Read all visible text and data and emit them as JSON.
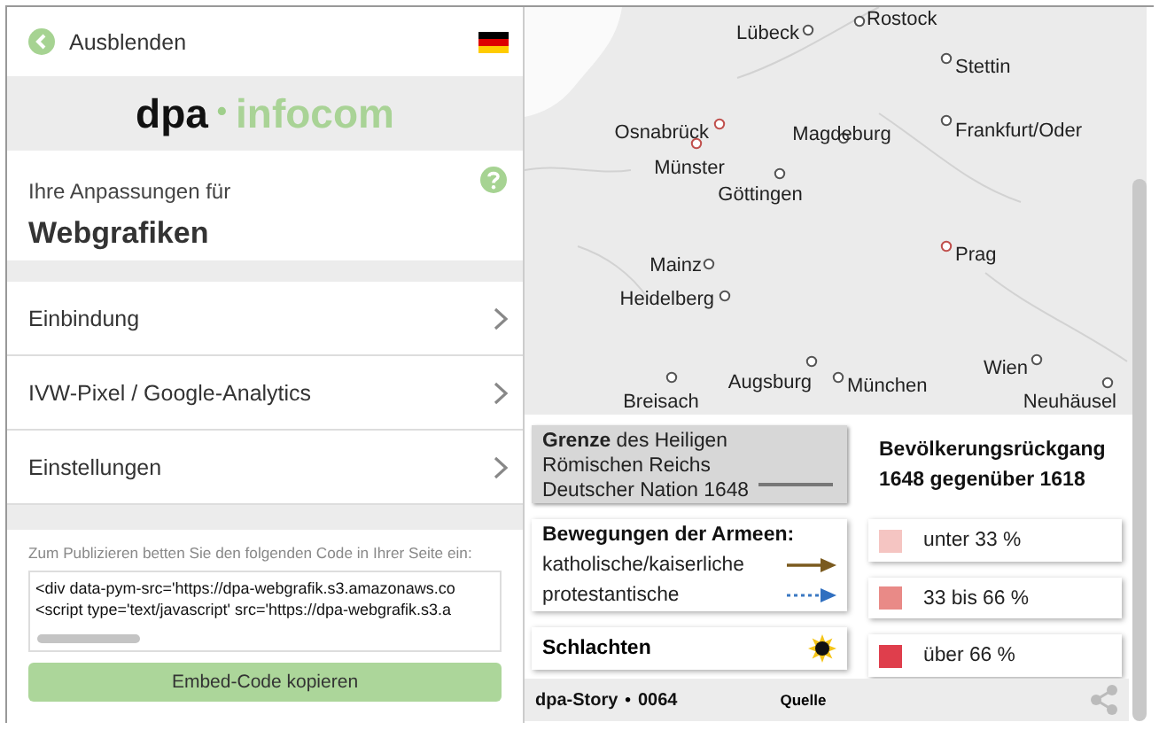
{
  "header": {
    "back_label": "Ausblenden"
  },
  "logo": {
    "part1": "dpa",
    "separator": "•",
    "part2": "infocom"
  },
  "intro": {
    "subtitle": "Ihre Anpassungen für",
    "title": "Webgrafiken"
  },
  "menu": [
    {
      "label": "Einbindung"
    },
    {
      "label": "IVW-Pixel / Google-Analytics"
    },
    {
      "label": "Einstellungen"
    }
  ],
  "embed": {
    "hint": "Zum Publizieren betten Sie den folgenden Code in Ihrer Seite ein:",
    "code_lines": [
      "<div data-pym-src='https://dpa-webgrafik.s3.amazonaws.co",
      "<script type='text/javascript' src='https://dpa-webgrafik.s3.a"
    ],
    "button": "Embed-Code kopieren"
  },
  "map": {
    "cities": [
      {
        "name": "Lübeck",
        "highlighted": false
      },
      {
        "name": "Rostock",
        "highlighted": false
      },
      {
        "name": "Stettin",
        "highlighted": false
      },
      {
        "name": "Osnabrück",
        "highlighted": true
      },
      {
        "name": "Münster",
        "highlighted": true
      },
      {
        "name": "Magdeburg",
        "highlighted": false
      },
      {
        "name": "Frankfurt/Oder",
        "highlighted": false
      },
      {
        "name": "Göttingen",
        "highlighted": false
      },
      {
        "name": "Mainz",
        "highlighted": false
      },
      {
        "name": "Heidelberg",
        "highlighted": false
      },
      {
        "name": "Prag",
        "highlighted": true
      },
      {
        "name": "Augsburg",
        "highlighted": false
      },
      {
        "name": "München",
        "highlighted": false
      },
      {
        "name": "Breisach",
        "highlighted": false
      },
      {
        "name": "Wien",
        "highlighted": false
      },
      {
        "name": "Neuhäusel",
        "highlighted": false
      }
    ]
  },
  "legend": {
    "border_text": "**Grenze** des Heiligen Römischen Reichs Deutscher Nation 1648",
    "movements": {
      "title": "Bewegungen der Armeen:",
      "items": [
        {
          "label": "katholische/kaiserliche",
          "kind": "solid"
        },
        {
          "label": "protestantische",
          "kind": "dashed"
        }
      ]
    },
    "battles": "Schlachten",
    "decline_title": "Bevölkerungsrückgang 1648 gegenüber 1618",
    "decline": [
      {
        "label": "unter 33 %",
        "color": "#f5c5c2"
      },
      {
        "label": "33 bis 66 %",
        "color": "#e98a87"
      },
      {
        "label": "über 66 %",
        "color": "#df3e4c"
      }
    ]
  },
  "footer": {
    "story": "dpa-Story",
    "separator": "•",
    "number": "0064",
    "source": "Quelle"
  }
}
